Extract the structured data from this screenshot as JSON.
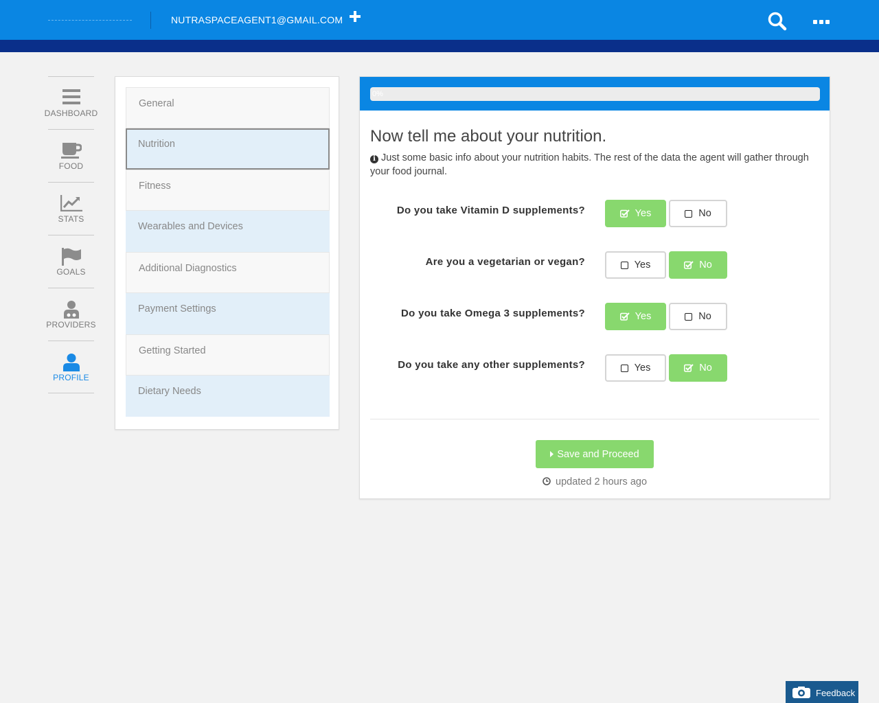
{
  "header": {
    "account_email": "NUTRASPACEAGENT1@GMAIL.COM",
    "add_icon": "plus-icon",
    "search_icon": "search-icon",
    "more_icon": "ellipsis-icon",
    "colors": {
      "bar": "#0a86e3",
      "strip": "#0a2f8a"
    }
  },
  "leftnav": {
    "items": [
      {
        "label": "DASHBOARD",
        "icon": "dashboard-icon",
        "active": false
      },
      {
        "label": "FOOD",
        "icon": "coffee-cup-icon",
        "active": false
      },
      {
        "label": "STATS",
        "icon": "line-chart-icon",
        "active": false
      },
      {
        "label": "GOALS",
        "icon": "flag-icon",
        "active": false
      },
      {
        "label": "PROVIDERS",
        "icon": "doctor-icon",
        "active": false
      },
      {
        "label": "PROFILE",
        "icon": "user-icon",
        "active": true
      }
    ]
  },
  "sections": {
    "items": [
      {
        "label": "General"
      },
      {
        "label": "Nutrition",
        "selected": true
      },
      {
        "label": "Fitness"
      },
      {
        "label": "Wearables and Devices"
      },
      {
        "label": "Additional Diagnostics"
      },
      {
        "label": "Payment Settings"
      },
      {
        "label": "Getting Started"
      },
      {
        "label": "Dietary Needs"
      }
    ]
  },
  "form": {
    "progress": {
      "value": 0,
      "text": "0%"
    },
    "title": "Now tell me about your nutrition.",
    "info": "Just some basic info about your nutrition habits. The rest of the data the agent will gather through your food journal.",
    "yes_label": "Yes",
    "no_label": "No",
    "questions": [
      {
        "label": "Do you take Vitamin D supplements?",
        "answer": "Yes"
      },
      {
        "label": "Are you a vegetarian or vegan?",
        "answer": "No"
      },
      {
        "label": "Do you take Omega 3 supplements?",
        "answer": "Yes"
      },
      {
        "label": "Do you take any other supplements?",
        "answer": "No"
      }
    ],
    "save_label": "Save and Proceed",
    "updated_text": "updated 2 hours ago",
    "colors": {
      "selected": "#88d86e"
    }
  },
  "feedback": {
    "label": "Feedback",
    "icon": "camera-eye-icon"
  }
}
